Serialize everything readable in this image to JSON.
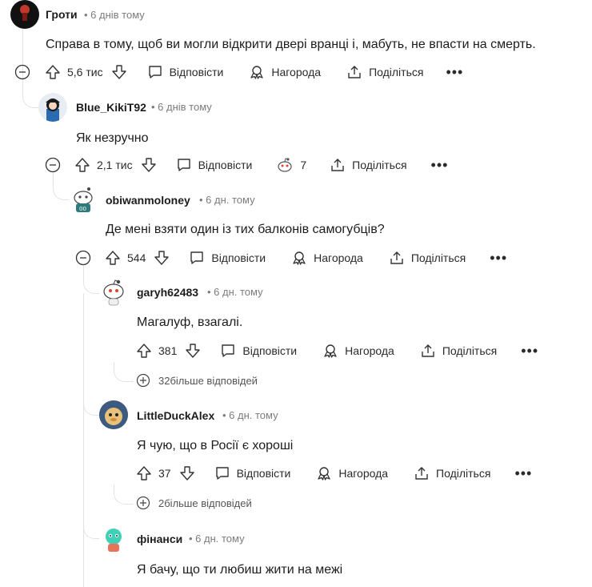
{
  "labels": {
    "reply": "Відповісти",
    "award": "Нагорода",
    "share": "Поділіться",
    "more_dots": "•••"
  },
  "comments": [
    {
      "author": "Гроти",
      "time": "• 6 днів тому",
      "text": "Справа в тому, щоб ви могли відкрити двері вранці і, мабуть, не впасти на смерть.",
      "votes": "5,6 тис"
    },
    {
      "author": "Blue_KikiT92",
      "time": "• 6 днів тому",
      "text": "Як незручно",
      "votes": "2,1 тис",
      "awards": "7"
    },
    {
      "author": "obiwanmoloney",
      "time": "• 6 дн. тому",
      "text": "Де мені взяти один із тих балконів самогубців?",
      "votes": "544"
    },
    {
      "author": "garyh62483",
      "time": "• 6 дн. тому",
      "text": "Магалуф, взагалі.",
      "votes": "381",
      "more_replies": "32більше відповідей"
    },
    {
      "author": "LittleDuckAlex",
      "time": "• 6 дн. тому",
      "text": "Я чую, що в Росії є хороші",
      "votes": "37",
      "more_replies": "2більше відповідей"
    },
    {
      "author": "фінанси",
      "time": "• 6 дн. тому",
      "text": "Я бачу, що ти любиш жити на межі"
    }
  ],
  "colors": {
    "thread": "#dfe3e6",
    "text": "#1c1c1c",
    "muted": "#7c7c7c"
  }
}
